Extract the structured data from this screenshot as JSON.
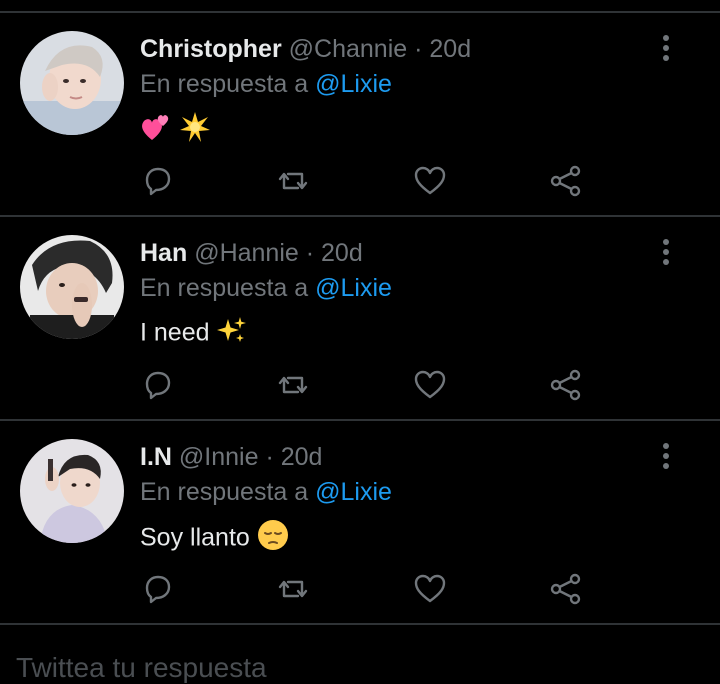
{
  "tweets": [
    {
      "name": "Christopher",
      "handle": "@Channie",
      "separator": "·",
      "time": "20d",
      "reply_prefix": "En respuesta a",
      "reply_to": "@Lixie",
      "text": "",
      "emoji": [
        "two-hearts",
        "sparkle-star"
      ]
    },
    {
      "name": "Han",
      "handle": "@Hannie",
      "separator": "·",
      "time": "20d",
      "reply_prefix": "En respuesta a",
      "reply_to": "@Lixie",
      "text": "I need",
      "emoji": [
        "sparkles"
      ]
    },
    {
      "name": "I.N",
      "handle": "@Innie",
      "separator": "·",
      "time": "20d",
      "reply_prefix": "En respuesta a",
      "reply_to": "@Lixie",
      "text": "Soy llanto",
      "emoji": [
        "pensive-face"
      ]
    }
  ],
  "compose": {
    "placeholder": "Twittea tu respuesta"
  },
  "colors": {
    "background": "#000000",
    "accent": "#1d9bf0",
    "muted": "#71767b",
    "divider": "#2f3336"
  }
}
